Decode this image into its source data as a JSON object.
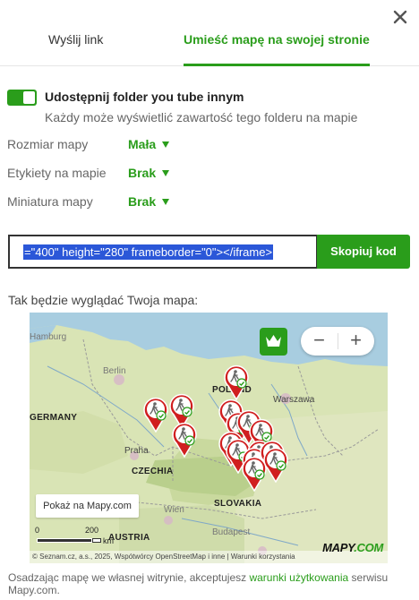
{
  "tabs": {
    "send_link": "Wyślij link",
    "embed": "Umieść mapę na swojej stronie"
  },
  "share": {
    "toggle_on": true,
    "label": "Udostępnij folder you tube innym",
    "description": "Każdy może wyświetlić zawartość tego folderu na mapie"
  },
  "options": {
    "size": {
      "label": "Rozmiar mapy",
      "value": "Mała"
    },
    "labels": {
      "label": "Etykiety na mapie",
      "value": "Brak"
    },
    "thumbnail": {
      "label": "Miniatura mapy",
      "value": "Brak"
    }
  },
  "embed_code": {
    "value": "=\"400\" height=\"280\" frameborder=\"0\"></iframe>",
    "copy_label": "Skopiuj kod"
  },
  "preview": {
    "label": "Tak będzie wyglądać Twoja mapa:",
    "show_on_mapy": "Pokaż na Mapy.com",
    "zoom_out": "−",
    "zoom_in": "+",
    "scale_0": "0",
    "scale_200": "200",
    "scale_unit": "km",
    "attribution": "© Seznam.cz, a.s., 2025, Wspótwórcy OpenStreetMap i inne | Warunki korzystania",
    "logo_main": "MAPY",
    "logo_dot": ".COM",
    "places": {
      "hamburg": "Hamburg",
      "berlin": "Berlin",
      "poland": "POLAND",
      "warszawa": "Warszawa",
      "germany": "GERMANY",
      "praha": "Praha",
      "czechia": "CZECHIA",
      "wien": "Wien",
      "austria": "AUSTRIA",
      "slovakia": "SLOVAKIA",
      "budapest": "Budapest"
    },
    "icons": {
      "crown": "crown-icon",
      "pin": "hiker-pin-icon",
      "close": "close-icon"
    }
  },
  "footer": {
    "text_before": "Osadzając mapę we własnej witrynie, akceptujesz ",
    "link": "warunki użytkowania",
    "text_after": " serwisu Mapy.com."
  },
  "colors": {
    "accent": "#2a9d1b",
    "pin_red": "#d01f1f",
    "selection": "#2b57d8"
  }
}
